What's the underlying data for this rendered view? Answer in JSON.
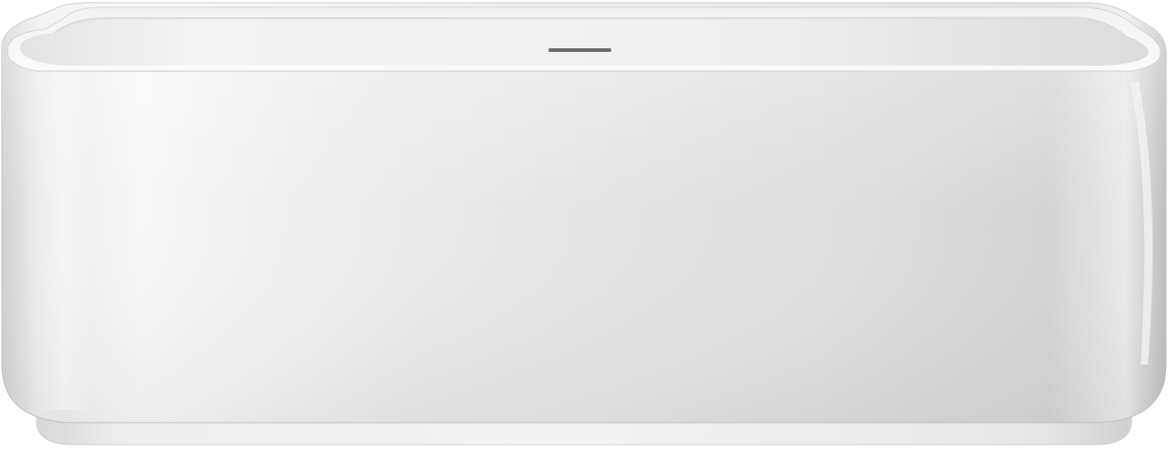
{
  "image": {
    "subject": "bathtub-product-photo",
    "colors": {
      "background": "#ffffff",
      "tub_body_light": "#f4f4f4",
      "tub_body_mid": "#e2e2e2",
      "tub_body_shadow": "#c9c9c9",
      "rim_top": "#f7f7f7",
      "interior": "#eeeeee",
      "drain_slot": "#6b6b6b",
      "base_plinth": "#ebebeb"
    }
  }
}
